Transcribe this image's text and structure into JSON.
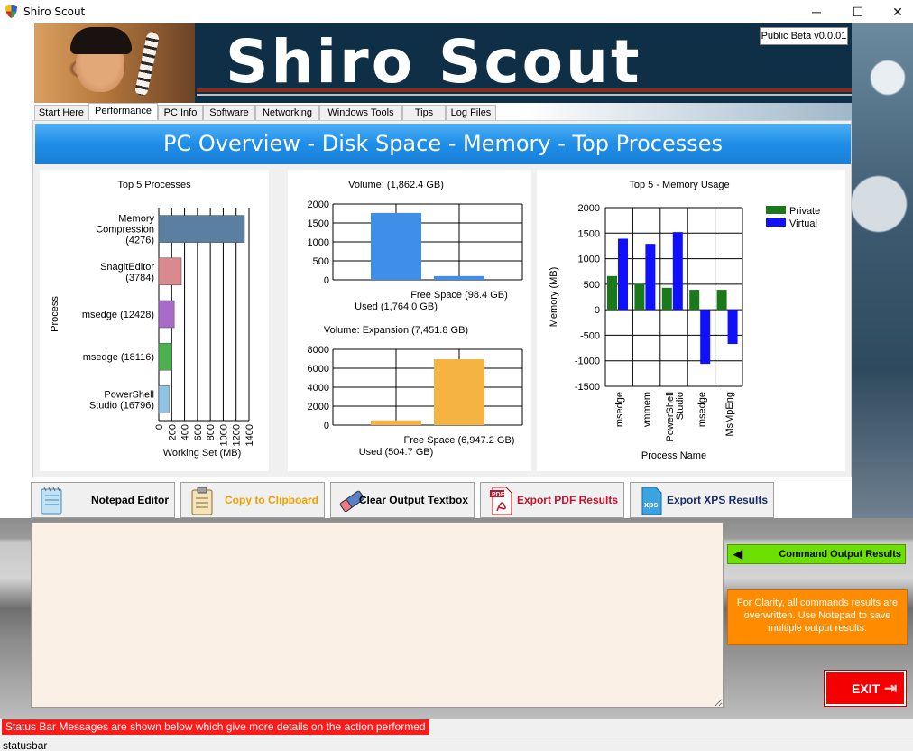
{
  "window": {
    "title": "Shiro Scout",
    "minimize": "─",
    "maximize": "☐",
    "close": "✕"
  },
  "banner": {
    "brand": "Shiro Scout",
    "version": "Public Beta v0.0.01"
  },
  "tabs": [
    "Start Here",
    "Performance",
    "PC Info",
    "Software",
    "Networking",
    "Windows Tools",
    "Tips",
    "Log Files"
  ],
  "active_tab": "Performance",
  "panel": {
    "title": "PC Overview - Disk Space - Memory - Top Processes"
  },
  "chart_data": [
    {
      "type": "bar",
      "orientation": "horizontal",
      "title": "Top 5 Processes",
      "xlabel": "Working Set (MB)",
      "ylabel": "Process",
      "categories": [
        "Memory Compression (4276)",
        "SnagitEditor (3784)",
        "msedge (12428)",
        "msedge (18116)",
        "PowerShell Studio (16796)"
      ],
      "values": [
        1330,
        350,
        240,
        200,
        160
      ],
      "colors": [
        "#5b7fa0",
        "#d98a8f",
        "#a86bc8",
        "#4caf50",
        "#8ec3e6"
      ],
      "xlim": [
        0,
        1400
      ],
      "xticks": [
        "0",
        "200",
        "400",
        "600",
        "800",
        "1000",
        "1200",
        "1400"
      ]
    },
    {
      "type": "bar",
      "title": "Volume:  (1,862.4 GB)",
      "categories": [
        "Used (1,764.0 GB)",
        "Free Space (98.4 GB)"
      ],
      "values": [
        1764.0,
        98.4
      ],
      "color": "#3f8ee8",
      "ylim": [
        0,
        2000
      ],
      "yticks": [
        "0",
        "500",
        "1000",
        "1500",
        "2000"
      ]
    },
    {
      "type": "bar",
      "title": "Volume: Expansion (7,451.8 GB)",
      "categories": [
        "Used (504.7 GB)",
        "Free Space (6,947.2 GB)"
      ],
      "values": [
        504.7,
        6947.2
      ],
      "color": "#f5b342",
      "ylim": [
        0,
        8000
      ],
      "yticks": [
        "0",
        "2000",
        "4000",
        "6000",
        "8000"
      ]
    },
    {
      "type": "bar",
      "title": "Top 5 - Memory Usage",
      "xlabel": "Process Name",
      "ylabel": "Memory (MB)",
      "categories": [
        "msedge",
        "vmmem",
        "PowerShell Studio",
        "msedge",
        "MsMpEng"
      ],
      "series": [
        {
          "name": "Private",
          "color": "#1a7a1a",
          "values": [
            660,
            510,
            430,
            390,
            390
          ]
        },
        {
          "name": "Virtual",
          "color": "#1010ff",
          "values": [
            1390,
            1290,
            1520,
            -1060,
            -670
          ]
        }
      ],
      "ylim": [
        -1500,
        2000
      ],
      "yticks": [
        "2000",
        "1500",
        "1000",
        "500",
        "0",
        "-500",
        "-1000",
        "-1500"
      ],
      "legend": "top-right"
    }
  ],
  "toolbar": {
    "notepad": "Notepad Editor",
    "clipboard": "Copy to Clipboard",
    "clear": "Clear Output Textbox",
    "pdf": "Export PDF Results",
    "xps": "Export XPS Results",
    "colors": {
      "notepad": "#000000",
      "clipboard": "#f0a000",
      "clear": "#000000",
      "pdf": "#c8102e",
      "xps": "#1a2b6b"
    }
  },
  "output": {
    "value": ""
  },
  "command_output": {
    "label": "Command Output Results",
    "arrow": "◀"
  },
  "clarity_note": "For Clarity, all commands results are overwritten. Use Notepad to save multiple output results.",
  "exit": {
    "label": "EXIT",
    "icon": "⇥"
  },
  "status": {
    "message": "Status Bar Messages are shown below which give more details on the action performed",
    "bar": "statusbar"
  }
}
